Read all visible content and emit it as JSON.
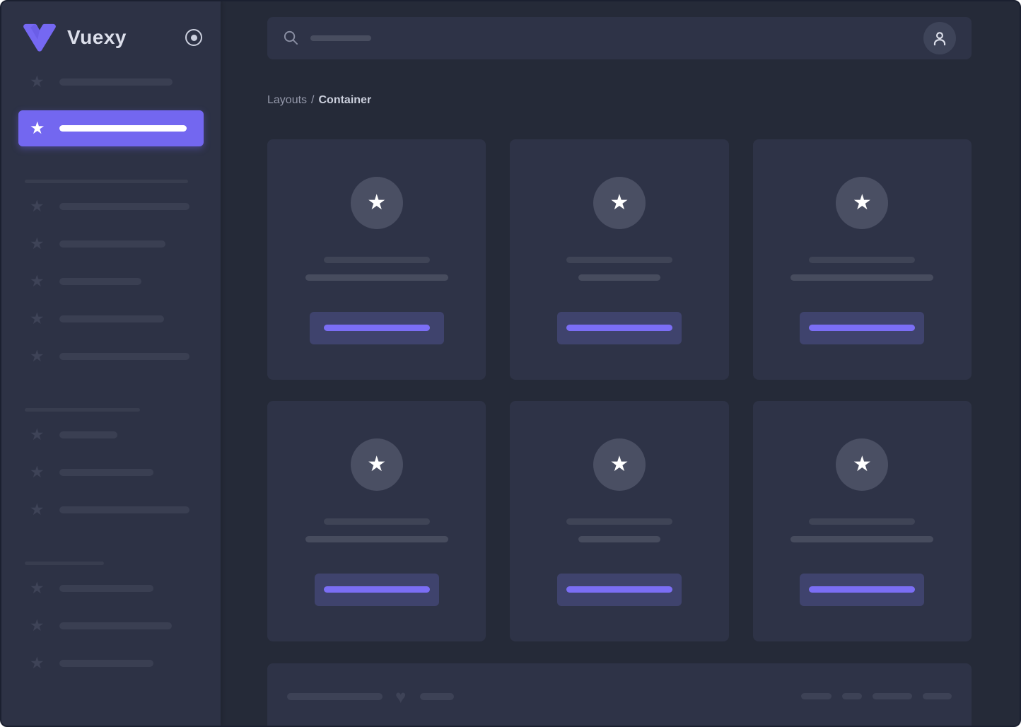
{
  "app": {
    "name": "Vuexy"
  },
  "header": {
    "search_icon": "magnifier",
    "user_icon": "person-outline"
  },
  "breadcrumb": {
    "section": "Layouts",
    "separator": "/",
    "current": "Container"
  },
  "icons": {
    "star": "★",
    "heart": "♥"
  },
  "colors": {
    "background": "#252a38",
    "sidebar": "#2d3245",
    "panel": "#2e3347",
    "accent": "#7367f0",
    "accent_bright": "#7b6ef5",
    "button_muted": "#3f436d",
    "skeleton_dark": "#3a3f52",
    "skeleton_light": "#474c5e",
    "text_light": "#dcdfeb",
    "text_muted": "#9599ab"
  },
  "sidebar": {
    "logo": "vuexy-v-mark",
    "toggle": "pin-radio-circle",
    "top_items": 1,
    "active_item_index": 1,
    "sections": [
      {
        "items": 5
      },
      {
        "items": 3
      },
      {
        "items": 3
      }
    ]
  },
  "content": {
    "cards_count": 6,
    "card_elements": [
      "star-circle",
      "line-skeleton",
      "line-skeleton",
      "button-skeleton"
    ]
  }
}
